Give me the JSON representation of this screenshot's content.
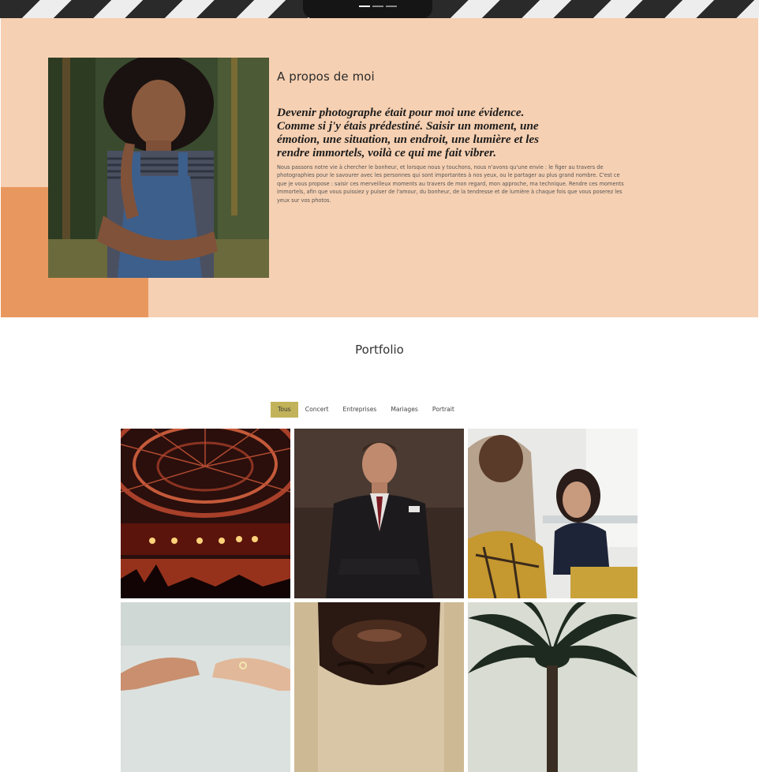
{
  "hero": {
    "slide_count": 3,
    "active_slide": 1
  },
  "about": {
    "title": "A propos de moi",
    "quote": "Devenir photographe était pour moi une évidence. Comme si j'y étais prédestiné. Saisir un moment, une émotion, une situation, un endroit, une lumière et les rendre immortels, voilà ce qui me fait vibrer.",
    "body": "Nous passons notre vie à chercher le bonheur, et lorsque nous y touchons, nous n'avons qu'une envie : le figer au travers de photographies pour le savourer avec les personnes qui sont importantes à nos yeux, ou le partager au plus grand nombre. C'est ce que je vous propose : saisir ces merveilleux moments au travers de mon regard, mon approche, ma technique. Rendre ces moments immortels, afin que vous puissiez y puiser de l'amour, du bonheur, de la tendresse et de lumière à chaque fois que vous poserez les yeux sur vos photos.",
    "photo_icon": "portrait-photo",
    "colors": {
      "background": "#f6d0b2",
      "accent": "#e8985e"
    }
  },
  "portfolio": {
    "title": "Portfolio",
    "filters": [
      "Tous",
      "Concert",
      "Entreprises",
      "Mariages",
      "Portrait"
    ],
    "active_filter": "Tous",
    "accent_color": "#c2b35a",
    "tiles": [
      {
        "icon": "concert-photo"
      },
      {
        "icon": "businessman-photo"
      },
      {
        "icon": "office-meeting-photo"
      },
      {
        "icon": "wedding-hands-photo"
      },
      {
        "icon": "portrait-face-photo"
      },
      {
        "icon": "palm-tree-photo"
      }
    ]
  }
}
